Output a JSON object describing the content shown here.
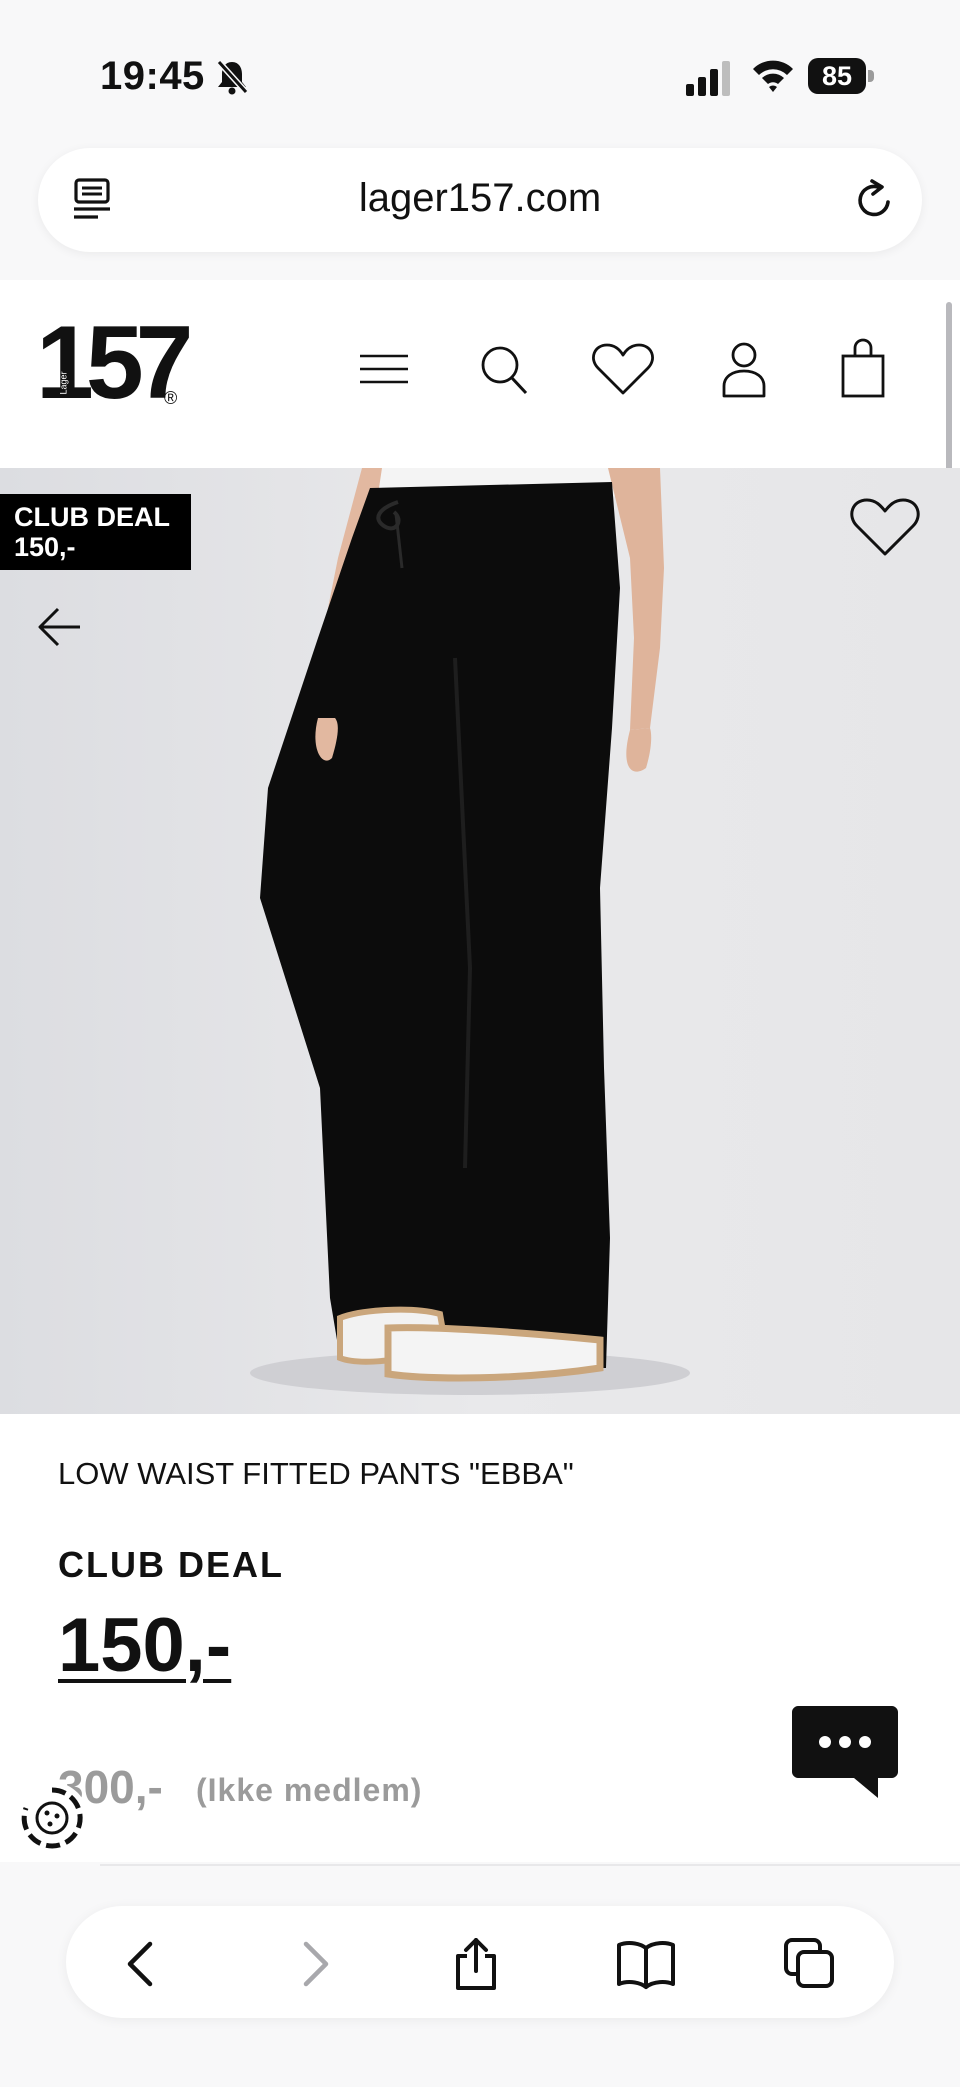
{
  "status_bar": {
    "time": "19:45",
    "battery": "85"
  },
  "browser": {
    "url": "lager157.com"
  },
  "site": {
    "logo_number": "157",
    "logo_small": "Lager",
    "logo_reg": "®"
  },
  "hero": {
    "badge_line1": "CLUB DEAL",
    "badge_line2": "150,-"
  },
  "product": {
    "name": "LOW WAIST FITTED PANTS \"EBBA\"",
    "deal_label": "CLUB DEAL",
    "deal_price": "150,-",
    "original_price": "300,-",
    "original_note": "(Ikke medlem)"
  },
  "icons": {
    "header": [
      "menu-icon",
      "search-icon",
      "heart-icon",
      "user-icon",
      "bag-icon"
    ],
    "safari": [
      "back-icon",
      "forward-icon",
      "share-icon",
      "bookmarks-icon",
      "tabs-icon"
    ]
  },
  "colors": {
    "accent": "#000000",
    "muted_price": "#9b9b9b",
    "page_bg": "#ffffff",
    "chrome_bg": "#f8f8f9"
  }
}
